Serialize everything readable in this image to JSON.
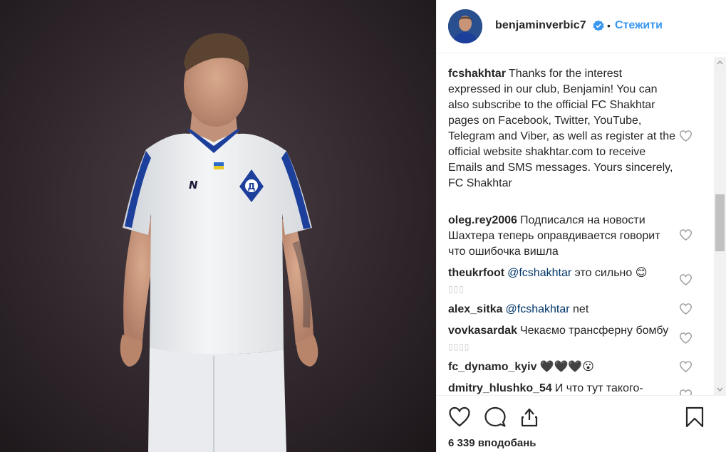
{
  "post": {
    "username": "benjaminverbic7",
    "separator": "•",
    "follow_label": "Стежити",
    "likes_text": "6 339 вподобань"
  },
  "comments": [
    {
      "user": "fcshakhtar",
      "text": "Thanks for the interest expressed in our club, Benjamin! You can also subscribe to the official FC Shakhtar pages on Facebook, Twitter, YouTube, Telegram and Viber, as well as register at the official website shakhtar.com to receive Emails and SMS messages. Yours sincerely, FC Shakhtar"
    },
    {
      "user": "oleg.rey2006",
      "text": "Подписался на новости Шахтера теперь оправдивается говорит что ошибочка вишла"
    },
    {
      "user": "theukrfoot",
      "mention": "@fcshakhtar",
      "text": " это сильно 😊",
      "tofu": "▯▯▯"
    },
    {
      "user": "alex_sitka",
      "mention": "@fcshakhtar",
      "text": " net"
    },
    {
      "user": "vovkasardak",
      "text": "Чекаємо трансферну бомбу",
      "tofu": "▯▯▯▯"
    },
    {
      "user": "fc_dynamo_kyiv",
      "text": "🖤🖤🖤😮"
    },
    {
      "user": "dmitry_hlushko_54",
      "text": "И что тут такого-"
    }
  ],
  "icons": {
    "verified": "verified-badge-icon",
    "like": "heart-icon",
    "comment": "comment-bubble-icon",
    "share": "share-icon",
    "save": "bookmark-icon"
  },
  "colors": {
    "link": "#3897f0",
    "mention": "#003569",
    "jersey_trim": "#1d3f9c"
  }
}
